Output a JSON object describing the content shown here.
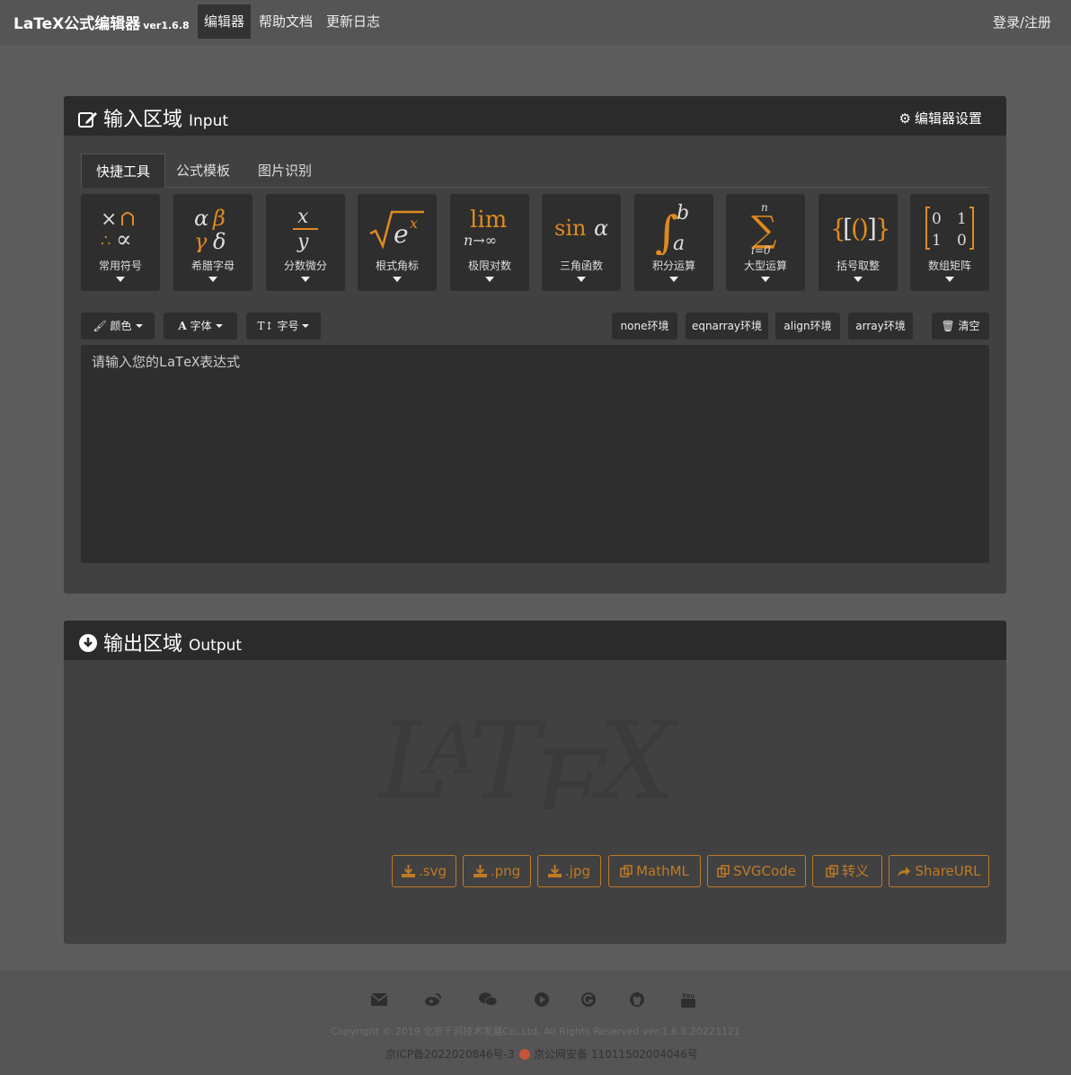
{
  "nav": {
    "brand": "LaTeX公式编辑器",
    "version": "ver1.6.8",
    "links": [
      "编辑器",
      "帮助文档",
      "更新日志"
    ],
    "login": "登录/注册"
  },
  "input_panel": {
    "title": "输入区域",
    "title_en": "Input",
    "settings": "编辑器设置",
    "tabs": [
      "快捷工具",
      "公式模板",
      "图片识别"
    ],
    "tools": [
      {
        "label": "常用符号",
        "icon": "common-symbols-icon"
      },
      {
        "label": "希腊字母",
        "icon": "greek-letters-icon"
      },
      {
        "label": "分数微分",
        "icon": "fraction-icon"
      },
      {
        "label": "根式角标",
        "icon": "radical-icon"
      },
      {
        "label": "极限对数",
        "icon": "limit-icon"
      },
      {
        "label": "三角函数",
        "icon": "trig-icon"
      },
      {
        "label": "积分运算",
        "icon": "integral-icon"
      },
      {
        "label": "大型运算",
        "icon": "sum-icon"
      },
      {
        "label": "括号取整",
        "icon": "brackets-icon"
      },
      {
        "label": "数组矩阵",
        "icon": "matrix-icon"
      }
    ],
    "format": {
      "color": "颜色",
      "font": "字体",
      "size": "字号"
    },
    "env_buttons": [
      "none环境",
      "eqnarray环境",
      "align环境",
      "array环境"
    ],
    "clear": "清空",
    "editor_placeholder": "请输入您的LaTeX表达式"
  },
  "output_panel": {
    "title": "输出区域",
    "title_en": "Output",
    "buttons": [
      ".svg",
      ".png",
      ".jpg",
      "MathML",
      "SVGCode",
      "转义",
      "ShareURL"
    ]
  },
  "footer": {
    "social_icons": [
      "mail-icon",
      "weibo-icon",
      "wechat-icon",
      "bilibili-icon",
      "google-icon",
      "github-icon",
      "youtube-icon"
    ],
    "copyright": "Copyright © 2019 北京千涧技术发展Co.,Ltd. All Rights Reserved  ver:1.6.8.20221121",
    "icp": "京ICP备2022020846号-3",
    "police": "京公网安备 11011502004046号"
  },
  "colors": {
    "accent": "#e08a1e",
    "bg": "#5c5c5c",
    "panel": "#414141",
    "panel_head": "#2b2b2b"
  }
}
